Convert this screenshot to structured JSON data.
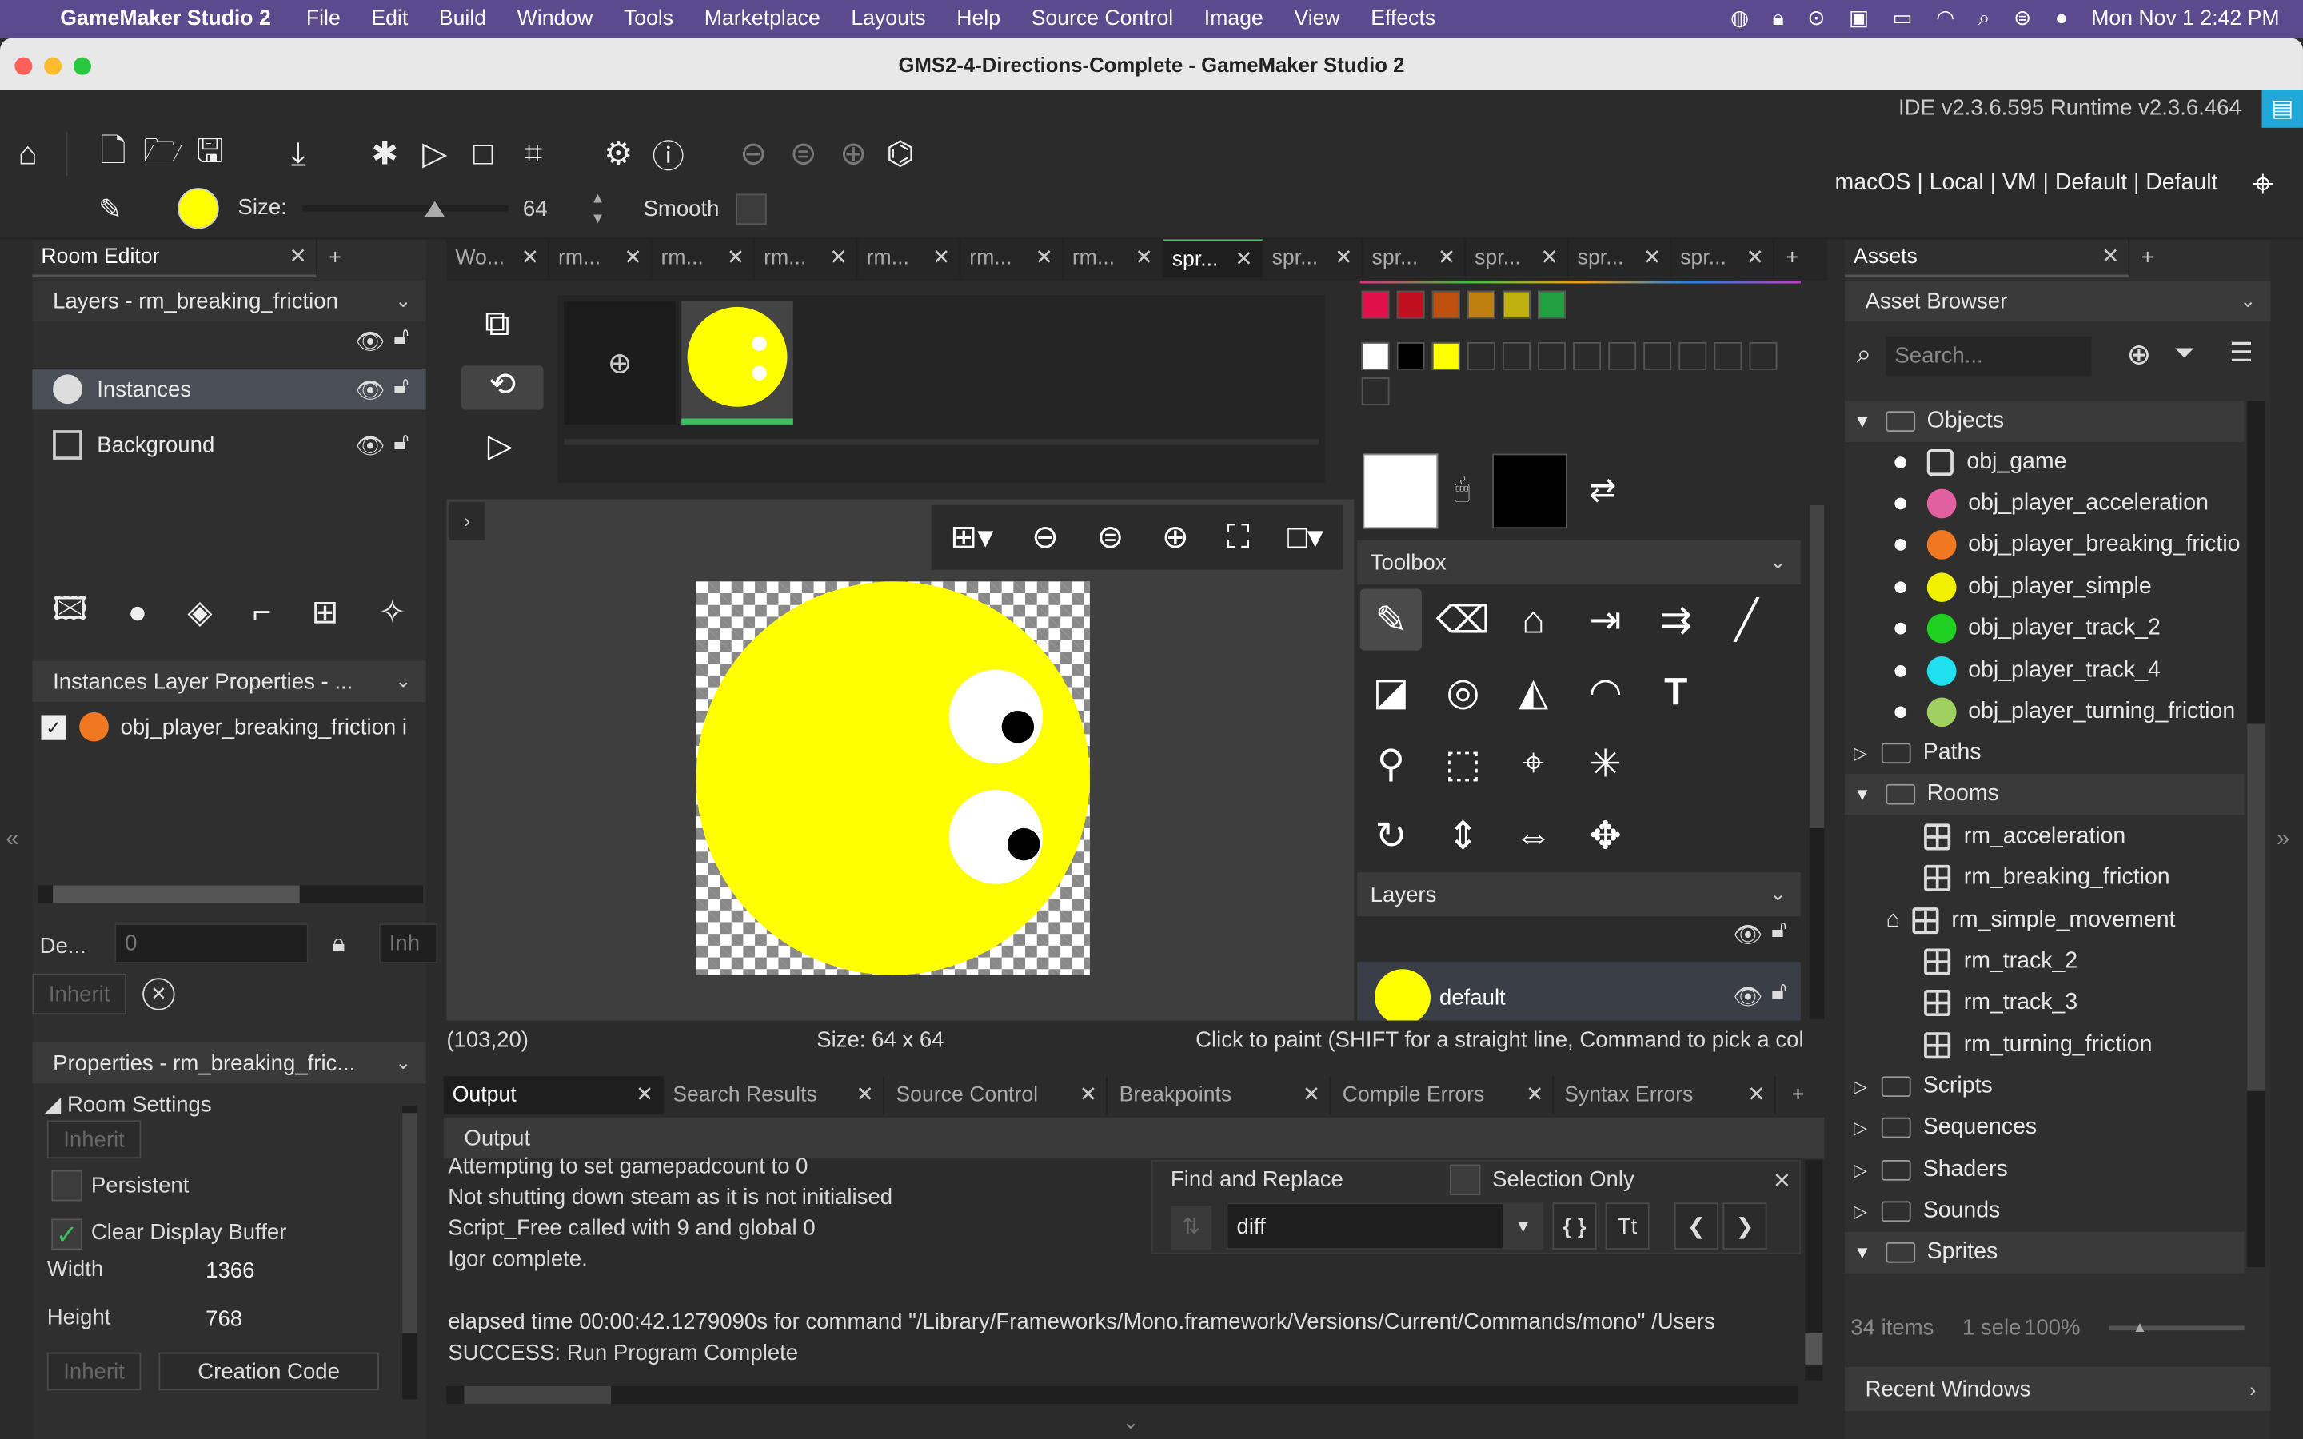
{
  "menubar": {
    "app": "GameMaker Studio 2",
    "items": [
      "File",
      "Edit",
      "Build",
      "Window",
      "Tools",
      "Marketplace",
      "Layouts",
      "Help",
      "Source Control",
      "Image",
      "View",
      "Effects"
    ],
    "clock": "Mon Nov 1  2:42 PM"
  },
  "window": {
    "title": "GMS2-4-Directions-Complete - GameMaker Studio 2"
  },
  "toolbar": {
    "version": "IDE v2.3.6.595  Runtime v2.3.6.464",
    "target": "macOS | Local | VM | Default | Default",
    "size_label": "Size:",
    "size_value": "64",
    "smooth_label": "Smooth"
  },
  "room_editor": {
    "tab": "Room Editor",
    "layers_header": "Layers - rm_breaking_friction",
    "layers": [
      "Instances",
      "Background"
    ],
    "inst_props_header": "Instances Layer Properties - ...",
    "instance": "obj_player_breaking_friction i",
    "depth_label": "De...",
    "depth_value": "0",
    "inherit_short": "Inh",
    "inherit": "Inherit",
    "props_header": "Properties - rm_breaking_fric...",
    "room_settings": "Room Settings",
    "persistent": "Persistent",
    "clear_display": "Clear Display Buffer",
    "width_label": "Width",
    "width_value": "1366",
    "height_label": "Height",
    "height_value": "768",
    "creation_code": "Creation Code"
  },
  "doc_tabs": [
    "Wo...",
    "rm...",
    "rm...",
    "rm...",
    "rm...",
    "rm...",
    "rm...",
    "spr...",
    "spr...",
    "spr...",
    "spr...",
    "spr...",
    "spr..."
  ],
  "sprite_editor": {
    "status_coords": "(103,20)",
    "status_size": "Size: 64 x 64",
    "status_hint": "Click to paint (SHIFT for a straight line, Command to pick a col",
    "toolbox": "Toolbox",
    "layers": "Layers",
    "layer_name": "default"
  },
  "output": {
    "tabs": [
      "Output",
      "Search Results",
      "Source Control",
      "Breakpoints",
      "Compile Errors",
      "Syntax Errors"
    ],
    "header": "Output",
    "lines": [
      "Attempting to set gamepadcount to 0",
      "Not shutting down steam as it is not initialised",
      "Script_Free called with 9 and global 0",
      "Igor complete."
    ],
    "lines2": [
      "elapsed time 00:00:42.1279090s for command \"/Library/Frameworks/Mono.framework/Versions/Current/Commands/mono\" /Users",
      "SUCCESS: Run Program Complete"
    ],
    "find_title": "Find and Replace",
    "selection_only": "Selection Only",
    "find_value": "diff"
  },
  "assets": {
    "tab": "Assets",
    "header": "Asset Browser",
    "search_placeholder": "Search...",
    "objects_folder": "Objects",
    "objects": [
      {
        "name": "obj_game",
        "color": ""
      },
      {
        "name": "obj_player_acceleration",
        "color": "#e060a0"
      },
      {
        "name": "obj_player_breaking_frictio",
        "color": "#f07820"
      },
      {
        "name": "obj_player_simple",
        "color": "#f0f000"
      },
      {
        "name": "obj_player_track_2",
        "color": "#20d020"
      },
      {
        "name": "obj_player_track_4",
        "color": "#20e0f0"
      },
      {
        "name": "obj_player_turning_friction",
        "color": "#a0d060"
      }
    ],
    "paths": "Paths",
    "rooms_folder": "Rooms",
    "rooms": [
      "rm_acceleration",
      "rm_breaking_friction",
      "rm_simple_movement",
      "rm_track_2",
      "rm_track_3",
      "rm_turning_friction"
    ],
    "folders_after": [
      "Scripts",
      "Sequences",
      "Shaders",
      "Sounds"
    ],
    "sprites": "Sprites",
    "footer_count": "34 items",
    "footer_sel": "1 sele",
    "footer_zoom": "100%",
    "recent": "Recent Windows"
  }
}
